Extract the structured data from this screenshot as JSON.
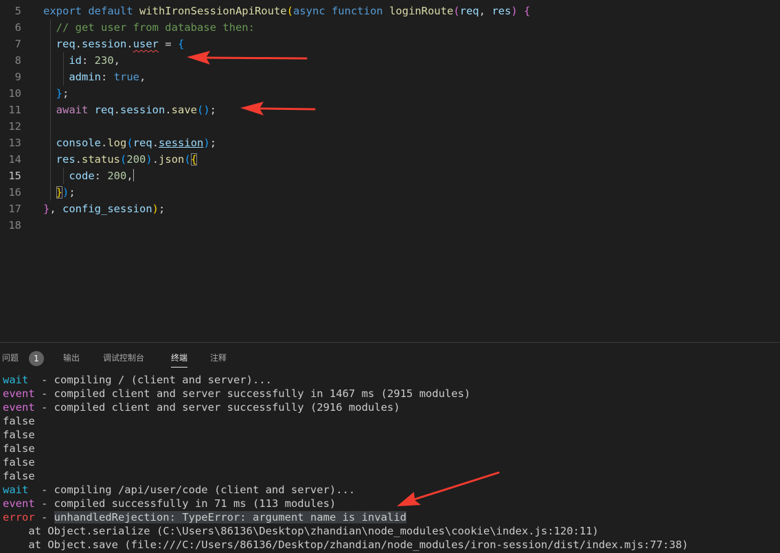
{
  "editor": {
    "lines": [
      {
        "n": "5",
        "parts": [
          {
            "t": "export ",
            "c": "kw"
          },
          {
            "t": "default ",
            "c": "kw"
          },
          {
            "t": "withIronSessionApiRoute",
            "c": "fn"
          },
          {
            "t": "(",
            "c": "p1"
          },
          {
            "t": "async ",
            "c": "kw"
          },
          {
            "t": "function ",
            "c": "kw"
          },
          {
            "t": "loginRoute",
            "c": "fn"
          },
          {
            "t": "(",
            "c": "p2"
          },
          {
            "t": "req",
            "c": "var"
          },
          {
            "t": ", ",
            "c": "pl"
          },
          {
            "t": "res",
            "c": "var"
          },
          {
            "t": ")",
            "c": "p2"
          },
          {
            "t": " ",
            "c": "pl"
          },
          {
            "t": "{",
            "c": "p2"
          }
        ]
      },
      {
        "n": "6",
        "parts": [
          {
            "t": "  // get user from database then:",
            "c": "cmt"
          }
        ]
      },
      {
        "n": "7",
        "parts": [
          {
            "t": "  req",
            "c": "var"
          },
          {
            "t": ".",
            "c": "pl"
          },
          {
            "t": "session",
            "c": "var"
          },
          {
            "t": ".",
            "c": "pl"
          },
          {
            "t": "user",
            "c": "var squig"
          },
          {
            "t": " = ",
            "c": "pl"
          },
          {
            "t": "{",
            "c": "p3"
          }
        ]
      },
      {
        "n": "8",
        "parts": [
          {
            "t": "    id",
            "c": "var"
          },
          {
            "t": ": ",
            "c": "pl"
          },
          {
            "t": "230",
            "c": "num"
          },
          {
            "t": ",",
            "c": "pl"
          }
        ]
      },
      {
        "n": "9",
        "parts": [
          {
            "t": "    admin",
            "c": "var"
          },
          {
            "t": ": ",
            "c": "pl"
          },
          {
            "t": "true",
            "c": "kw"
          },
          {
            "t": ",",
            "c": "pl"
          }
        ]
      },
      {
        "n": "10",
        "parts": [
          {
            "t": "  ",
            "c": "pl"
          },
          {
            "t": "}",
            "c": "p3"
          },
          {
            "t": ";",
            "c": "pl"
          }
        ]
      },
      {
        "n": "11",
        "parts": [
          {
            "t": "  await ",
            "c": "kw2"
          },
          {
            "t": "req",
            "c": "var"
          },
          {
            "t": ".",
            "c": "pl"
          },
          {
            "t": "session",
            "c": "var"
          },
          {
            "t": ".",
            "c": "pl"
          },
          {
            "t": "save",
            "c": "fn"
          },
          {
            "t": "()",
            "c": "p3"
          },
          {
            "t": ";",
            "c": "pl"
          }
        ]
      },
      {
        "n": "12",
        "parts": []
      },
      {
        "n": "13",
        "parts": [
          {
            "t": "  console",
            "c": "var"
          },
          {
            "t": ".",
            "c": "pl"
          },
          {
            "t": "log",
            "c": "fn"
          },
          {
            "t": "(",
            "c": "p3"
          },
          {
            "t": "req",
            "c": "var"
          },
          {
            "t": ".",
            "c": "pl"
          },
          {
            "t": "session",
            "c": "ulink"
          },
          {
            "t": ")",
            "c": "p3"
          },
          {
            "t": ";",
            "c": "pl"
          }
        ]
      },
      {
        "n": "14",
        "parts": [
          {
            "t": "  res",
            "c": "var"
          },
          {
            "t": ".",
            "c": "pl"
          },
          {
            "t": "status",
            "c": "fn"
          },
          {
            "t": "(",
            "c": "p3"
          },
          {
            "t": "200",
            "c": "num"
          },
          {
            "t": ")",
            "c": "p3"
          },
          {
            "t": ".",
            "c": "pl"
          },
          {
            "t": "json",
            "c": "fn"
          },
          {
            "t": "(",
            "c": "p3"
          },
          {
            "t": "{",
            "c": "p1 bracket-box"
          }
        ]
      },
      {
        "n": "15",
        "active": true,
        "cursor": true,
        "parts": [
          {
            "t": "    code",
            "c": "var"
          },
          {
            "t": ": ",
            "c": "pl"
          },
          {
            "t": "200",
            "c": "num"
          },
          {
            "t": ",",
            "c": "pl"
          }
        ]
      },
      {
        "n": "16",
        "parts": [
          {
            "t": "  ",
            "c": "pl"
          },
          {
            "t": "}",
            "c": "p1 bracket-box"
          },
          {
            "t": ")",
            "c": "p3"
          },
          {
            "t": ";",
            "c": "pl"
          }
        ]
      },
      {
        "n": "17",
        "parts": [
          {
            "t": "}",
            "c": "p2"
          },
          {
            "t": ", ",
            "c": "pl"
          },
          {
            "t": "config_session",
            "c": "var"
          },
          {
            "t": ")",
            "c": "p1"
          },
          {
            "t": ";",
            "c": "pl"
          }
        ]
      },
      {
        "n": "18",
        "parts": []
      }
    ]
  },
  "panel": {
    "tabs": [
      {
        "id": "problems",
        "label": "问题",
        "badge": "1"
      },
      {
        "id": "output",
        "label": "输出"
      },
      {
        "id": "debug-console",
        "label": "调试控制台"
      },
      {
        "id": "terminal",
        "label": "终端",
        "active": true
      },
      {
        "id": "comments",
        "label": "注释"
      }
    ],
    "terminal_lines": [
      {
        "tag": "wait",
        "tagc": "t-wait",
        "text": "  - compiling / (client and server)..."
      },
      {
        "tag": "event",
        "tagc": "t-event",
        "text": " - compiled client and server successfully in 1467 ms (2915 modules)"
      },
      {
        "tag": "event",
        "tagc": "t-event",
        "text": " - compiled client and server successfully (2916 modules)"
      },
      {
        "tag": "",
        "text": "false"
      },
      {
        "tag": "",
        "text": "false"
      },
      {
        "tag": "",
        "text": "false"
      },
      {
        "tag": "",
        "text": "false"
      },
      {
        "tag": "",
        "text": "false"
      },
      {
        "tag": "wait",
        "tagc": "t-wait",
        "text": "  - compiling /api/user/code (client and server)..."
      },
      {
        "tag": "event",
        "tagc": "t-event",
        "text": " - compiled successfully in 71 ms (113 modules)"
      },
      {
        "tag": "error",
        "tagc": "t-error",
        "text": " - ",
        "hl": "unhandledRejection: TypeError: argument name is invalid"
      },
      {
        "tag": "",
        "text": "    at Object.serialize (C:\\Users\\86136\\Desktop\\zhandian\\node_modules\\cookie\\index.js:120:11)"
      },
      {
        "tag": "",
        "text": "    at Object.save (file:///C:/Users/86136/Desktop/zhandian/node_modules/iron-session/dist/index.mjs:77:38)"
      }
    ]
  },
  "colors": {
    "arrow": "#f23b2f",
    "background": "#1e1e1e"
  }
}
